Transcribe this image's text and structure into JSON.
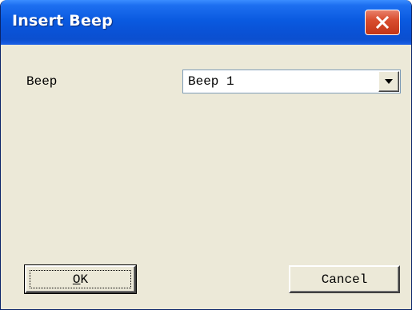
{
  "window": {
    "title": "Insert Beep",
    "colors": {
      "titlebar": "#0a52d6",
      "body": "#ece9d8",
      "close": "#d94e2f"
    }
  },
  "form": {
    "beep_label": "Beep",
    "beep_select": {
      "selected": "Beep 1"
    }
  },
  "buttons": {
    "ok_label": "OK",
    "cancel_label": "Cancel"
  },
  "icons": {
    "close": "close-icon",
    "dropdown": "chevron-down-icon"
  }
}
